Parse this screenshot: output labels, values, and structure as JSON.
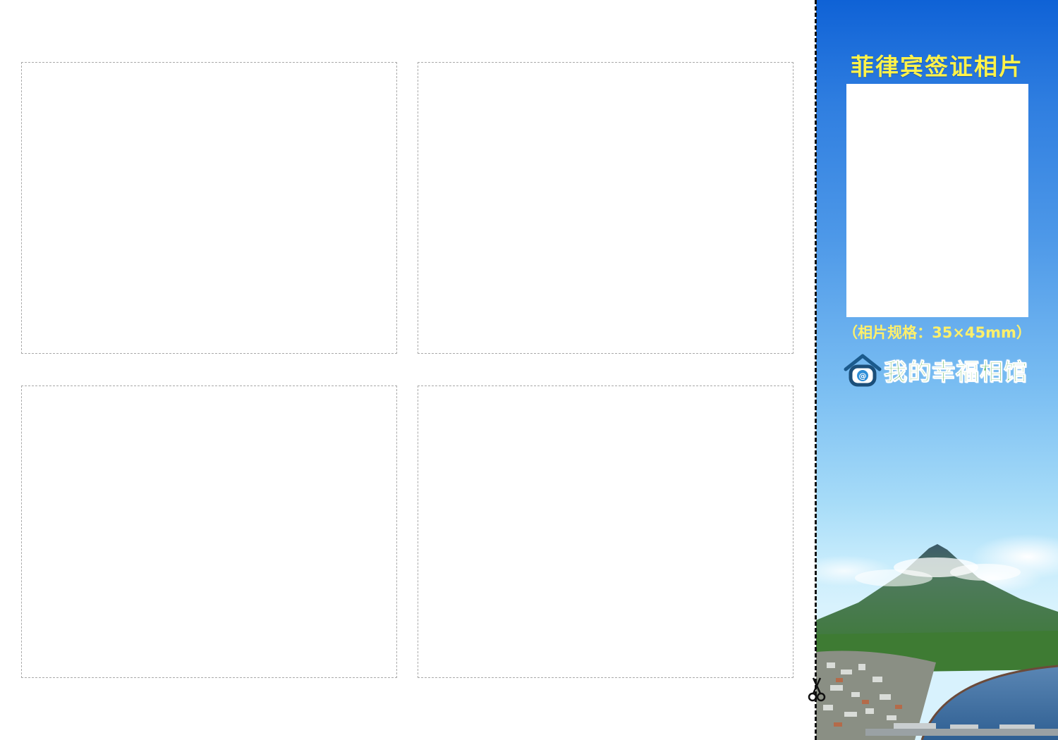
{
  "panel": {
    "title": "菲律宾签证相片",
    "photo_spec": "（相片规格：35×45mm）",
    "brand_name": "我的幸福相馆",
    "brand_icon": "house-at-icon"
  },
  "slots": [
    "photo-slot-1",
    "photo-slot-2",
    "photo-slot-3",
    "photo-slot-4"
  ],
  "icons": {
    "scissors": "scissors-icon"
  },
  "colors": {
    "panel_top": "#0f62d6",
    "panel_bottom": "#d8f2fd",
    "title_yellow": "#fff24a",
    "brand_green": "#2e9e2a",
    "slot_border": "#a9a9a9"
  }
}
